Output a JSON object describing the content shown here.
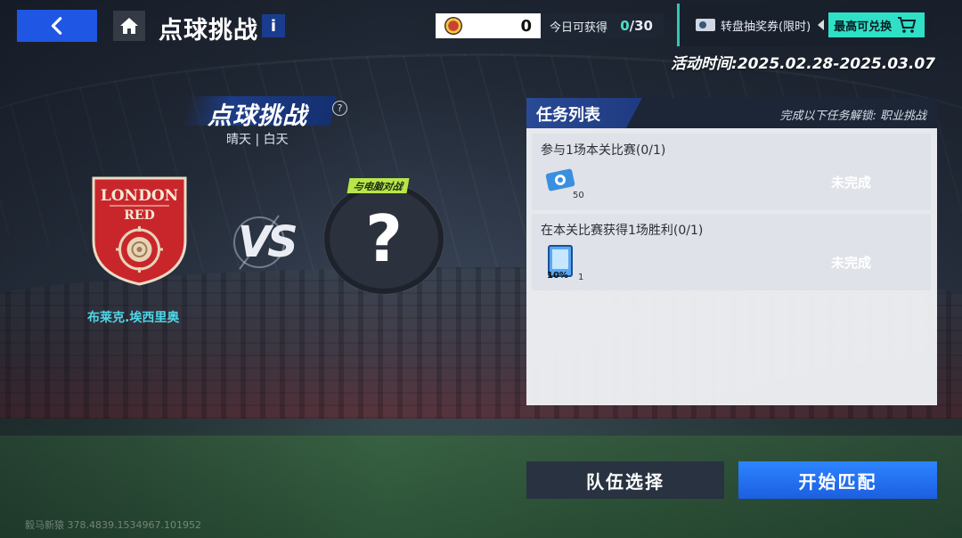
{
  "header": {
    "title": "点球挑战",
    "info_label": "i"
  },
  "currency": {
    "value": "0",
    "daily_label": "今日可获得",
    "daily_count": "0",
    "daily_max": "/30"
  },
  "promo": {
    "text": "转盘抽奖券(限时)",
    "redeem_label": "最高可兑换"
  },
  "event_time": "活动时间:2025.02.28-2025.03.07",
  "match": {
    "mode_title": "点球挑战",
    "help_label": "?",
    "weather": "晴天 | 白天",
    "home_badge_line1": "LONDON",
    "home_badge_line2": "RED",
    "home_name": "布莱克.埃西里奥",
    "vs_label": "VS",
    "opponent_tag": "与电脑对战",
    "opponent_placeholder": "?"
  },
  "tasks": {
    "header": "任务列表",
    "unlock_text": "完成以下任务解锁: 职业挑战",
    "items": [
      {
        "title": "参与1场本关比赛(0/1)",
        "status": "未完成",
        "reward_qty": "50"
      },
      {
        "title": "在本关比赛获得1场胜利(0/1)",
        "status": "未完成",
        "reward_qty": "1",
        "reward_badge": "10%"
      }
    ]
  },
  "buttons": {
    "team_select": "队伍选择",
    "start_match": "开始匹配"
  },
  "watermark": "毅马新猿 378.4839.1534967.101952"
}
